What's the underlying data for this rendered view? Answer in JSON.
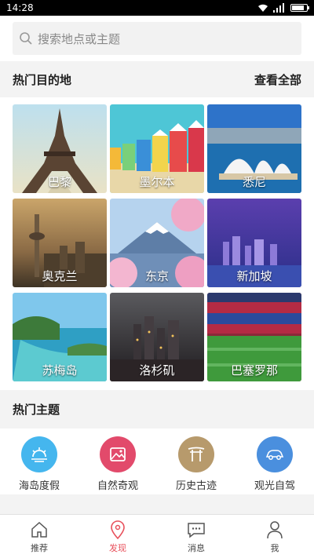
{
  "status_bar": {
    "time": "14:28",
    "battery_percent": 85
  },
  "search": {
    "placeholder": "搜索地点或主题"
  },
  "hot_destinations": {
    "title": "热门目的地",
    "view_all": "查看全部",
    "items": [
      {
        "label": "巴黎"
      },
      {
        "label": "墨尔本"
      },
      {
        "label": "悉尼"
      },
      {
        "label": "奥克兰"
      },
      {
        "label": "东京"
      },
      {
        "label": "新加坡"
      },
      {
        "label": "苏梅岛"
      },
      {
        "label": "洛杉矶"
      },
      {
        "label": "巴塞罗那"
      }
    ]
  },
  "hot_themes": {
    "title": "热门主题",
    "items": [
      {
        "label": "海岛度假",
        "color": "#45b6ee",
        "icon": "sunset-icon"
      },
      {
        "label": "自然奇观",
        "color": "#e24a6b",
        "icon": "landscape-icon"
      },
      {
        "label": "历史古迹",
        "color": "#b79a6c",
        "icon": "gate-icon"
      },
      {
        "label": "观光自驾",
        "color": "#4a8fde",
        "icon": "car-icon"
      }
    ]
  },
  "bottom_nav": {
    "accent": "#e8505b",
    "items": [
      {
        "label": "推荐",
        "icon": "home-icon",
        "active": false
      },
      {
        "label": "发现",
        "icon": "location-pin-icon",
        "active": true
      },
      {
        "label": "消息",
        "icon": "message-icon",
        "active": false
      },
      {
        "label": "我",
        "icon": "person-icon",
        "active": false
      }
    ]
  }
}
